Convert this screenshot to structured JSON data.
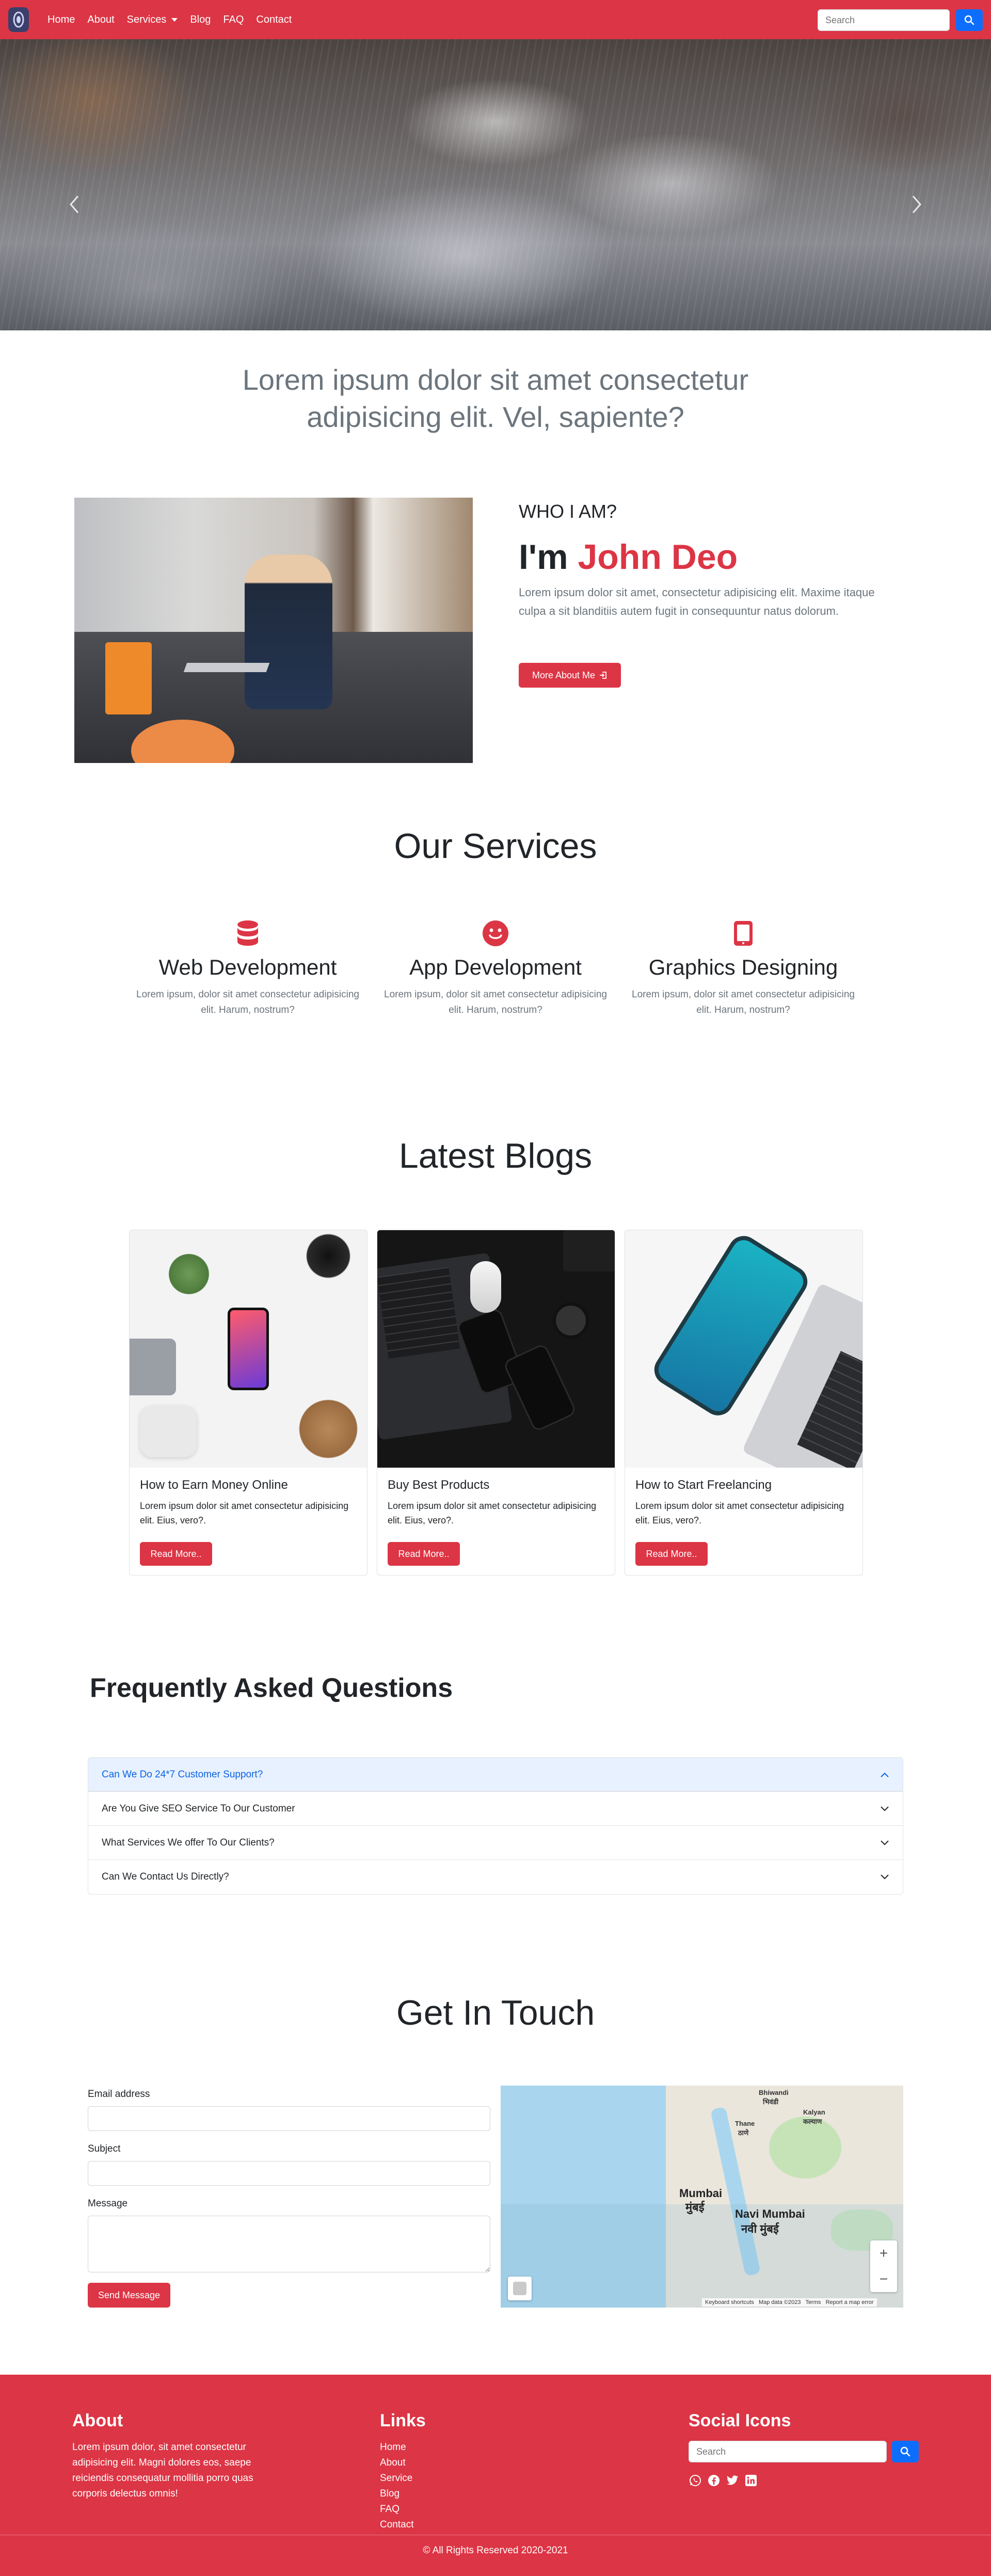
{
  "nav": {
    "items": [
      {
        "label": "Home"
      },
      {
        "label": "About"
      },
      {
        "label": "Services"
      },
      {
        "label": "Blog"
      },
      {
        "label": "FAQ"
      },
      {
        "label": "Contact"
      }
    ],
    "search_placeholder": "Search"
  },
  "tagline": "Lorem ipsum dolor sit amet consectetur adipisicing elit. Vel, sapiente?",
  "about": {
    "who": "WHO I AM?",
    "intro": "I'm",
    "name": "John Deo",
    "text": "Lorem ipsum dolor sit amet, consectetur adipisicing elit. Maxime itaque culpa a sit blanditiis autem fugit in consequuntur natus dolorum.",
    "button": "More About Me"
  },
  "services": {
    "title": "Our Services",
    "items": [
      {
        "title": "Web Development",
        "text": "Lorem ipsum, dolor sit amet consectetur adipisicing elit. Harum, nostrum?",
        "icon": "database-icon"
      },
      {
        "title": "App Development",
        "text": "Lorem ipsum, dolor sit amet consectetur adipisicing elit. Harum, nostrum?",
        "icon": "smiley-icon"
      },
      {
        "title": "Graphics Designing",
        "text": "Lorem ipsum, dolor sit amet consectetur adipisicing elit. Harum, nostrum?",
        "icon": "tablet-icon"
      }
    ]
  },
  "blogs": {
    "title": "Latest Blogs",
    "items": [
      {
        "title": "How to Earn Money Online",
        "text": "Lorem ipsum dolor sit amet consectetur adipisicing elit. Eius, vero?.",
        "button": "Read More.."
      },
      {
        "title": "Buy Best Products",
        "text": "Lorem ipsum dolor sit amet consectetur adipisicing elit. Eius, vero?.",
        "button": "Read More.."
      },
      {
        "title": "How to Start Freelancing",
        "text": "Lorem ipsum dolor sit amet consectetur adipisicing elit. Eius, vero?.",
        "button": "Read More.."
      }
    ]
  },
  "faq": {
    "title": "Frequently Asked Questions",
    "items": [
      {
        "question": "Can We Do 24*7 Customer Support?",
        "expanded": true
      },
      {
        "question": "Are You Give SEO Service To Our Customer",
        "expanded": false
      },
      {
        "question": "What Services We offer To Our Clients?",
        "expanded": false
      },
      {
        "question": "Can We Contact Us Directly?",
        "expanded": false
      }
    ]
  },
  "contact": {
    "title": "Get In Touch",
    "email_label": "Email address",
    "subject_label": "Subject",
    "message_label": "Message",
    "send_button": "Send Message",
    "map": {
      "labels": [
        "Bhiwandi",
        "भिवंडी",
        "Kalyan",
        "कल्याण",
        "Thane",
        "ठाणे",
        "Mumbai",
        "मुंबई",
        "Navi Mumbai",
        "नवी मुंबई"
      ],
      "attribution": [
        "Keyboard shortcuts",
        "Map data ©2023",
        "Terms",
        "Report a map error"
      ]
    }
  },
  "footer": {
    "about_title": "About",
    "about_text": "Lorem ipsum dolor, sit amet consectetur adipisicing elit. Magni dolores eos, saepe reiciendis consequatur mollitia porro quas corporis delectus omnis!",
    "links_title": "Links",
    "links": [
      "Home",
      "About",
      "Service",
      "Blog",
      "FAQ",
      "Contact"
    ],
    "social_title": "Social Icons",
    "search_placeholder": "Search",
    "social_icons": [
      "whatsapp-icon",
      "facebook-icon",
      "twitter-icon",
      "linkedin-icon"
    ],
    "copyright": "© All Rights Reserved 2020-2021"
  },
  "colors": {
    "brand_red": "#dc3545",
    "primary_blue": "#0d6efd",
    "accordion_active_bg": "#e7f1ff",
    "muted_text": "#6c757d"
  }
}
